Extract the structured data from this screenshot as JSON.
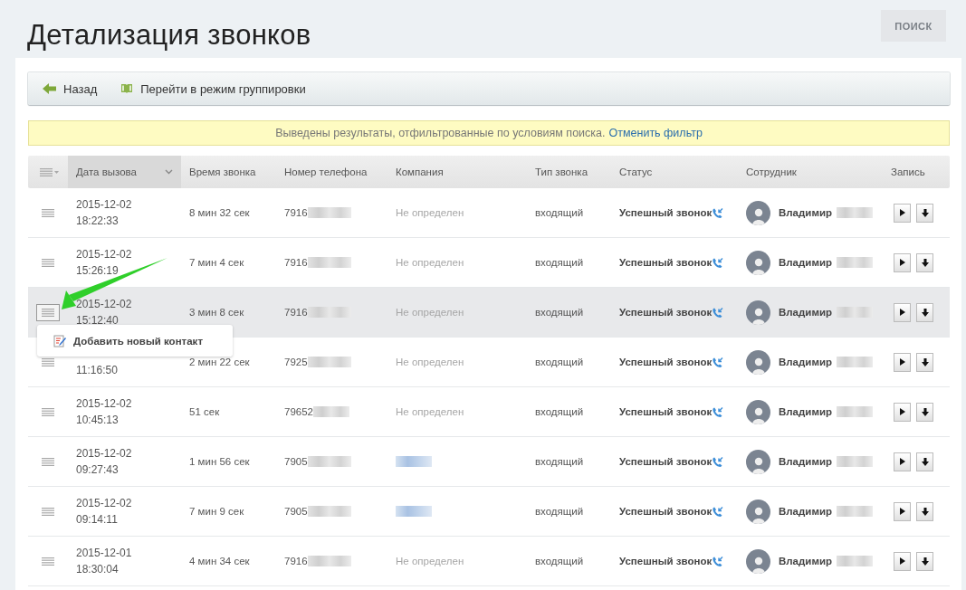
{
  "page_title": "Детализация звонков",
  "search_button": "ПОИСК",
  "toolbar": [
    {
      "kind": "back",
      "label": "Назад"
    },
    {
      "kind": "book",
      "label": "Перейти в режим группировки"
    }
  ],
  "notice": {
    "text": "Выведены результаты, отфильтрованные по условиям поиска.",
    "link": "Отменить фильтр"
  },
  "table": {
    "columns": [
      {
        "kind": "menu",
        "sorted": false
      },
      {
        "label": "Дата вызова",
        "sorted": true
      },
      {
        "label": "Время звонка",
        "sorted": false
      },
      {
        "label": "Номер телефона",
        "sorted": false
      },
      {
        "label": "Компания",
        "sorted": false
      },
      {
        "label": "Тип звонка",
        "sorted": false
      },
      {
        "label": "Статус",
        "sorted": false
      },
      {
        "label": "Сотрудник",
        "sorted": false
      },
      {
        "label": "Запись",
        "sorted": false
      }
    ],
    "rows": [
      {
        "selected": false,
        "menu_open": false,
        "date": "2015-12-02",
        "time": "18:22:33",
        "duration": "8 мин 32 сек",
        "phone": "7916",
        "phone_blurred": true,
        "company": {
          "kind": "text",
          "text": "Не определен"
        },
        "type": "входящий",
        "status": "Успешный звонок",
        "employee": "Владимир",
        "employee_blurred": true
      },
      {
        "selected": false,
        "menu_open": false,
        "date": "2015-12-02",
        "time": "15:26:19",
        "duration": "7 мин 4 сек",
        "phone": "7916",
        "phone_blurred": true,
        "company": {
          "kind": "text",
          "text": "Не определен"
        },
        "type": "входящий",
        "status": "Успешный звонок",
        "employee": "Владимир",
        "employee_blurred": true
      },
      {
        "selected": true,
        "menu_open": true,
        "date": "2015-12-02",
        "time": "15:12:40",
        "duration": "3 мин 8 сек",
        "phone": "7916",
        "phone_blurred": true,
        "company": {
          "kind": "text",
          "text": "Не определен"
        },
        "type": "входящий",
        "status": "Успешный звонок",
        "employee": "Владимир",
        "employee_blurred": true
      },
      {
        "selected": false,
        "menu_open": false,
        "time": "11:16:50",
        "duration": "2 мин 22 сек",
        "phone": "7925",
        "phone_blurred": true,
        "company": {
          "kind": "text",
          "text": "Не определен"
        },
        "type": "входящий",
        "status": "Успешный звонок",
        "employee": "Владимир",
        "employee_blurred": true
      },
      {
        "selected": false,
        "menu_open": false,
        "date": "2015-12-02",
        "time": "10:45:13",
        "duration": "51 сек",
        "phone": "79652",
        "phone_blurred": true,
        "company": {
          "kind": "text",
          "text": "Не определен"
        },
        "type": "входящий",
        "status": "Успешный звонок",
        "employee": "Владимир",
        "employee_blurred": true
      },
      {
        "selected": false,
        "menu_open": false,
        "date": "2015-12-02",
        "time": "09:27:43",
        "duration": "1 мин 56 сек",
        "phone": "7905",
        "phone_blurred": true,
        "company": {
          "kind": "blurred"
        },
        "type": "входящий",
        "status": "Успешный звонок",
        "employee": "Владимир",
        "employee_blurred": true
      },
      {
        "selected": false,
        "menu_open": false,
        "date": "2015-12-02",
        "time": "09:14:11",
        "duration": "7 мин 9 сек",
        "phone": "7905",
        "phone_blurred": true,
        "company": {
          "kind": "blurred"
        },
        "type": "входящий",
        "status": "Успешный звонок",
        "employee": "Владимир",
        "employee_blurred": true
      },
      {
        "selected": false,
        "menu_open": false,
        "date": "2015-12-01",
        "time": "18:30:04",
        "duration": "4 мин 34 сек",
        "phone": "7916",
        "phone_blurred": true,
        "company": {
          "kind": "text",
          "text": "Не определен"
        },
        "type": "входящий",
        "status": "Успешный звонок",
        "employee": "Владимир",
        "employee_blurred": true
      }
    ]
  },
  "row_menu": {
    "items": [
      "Добавить новый контакт"
    ]
  },
  "annotation": {
    "kind": "arrow"
  }
}
